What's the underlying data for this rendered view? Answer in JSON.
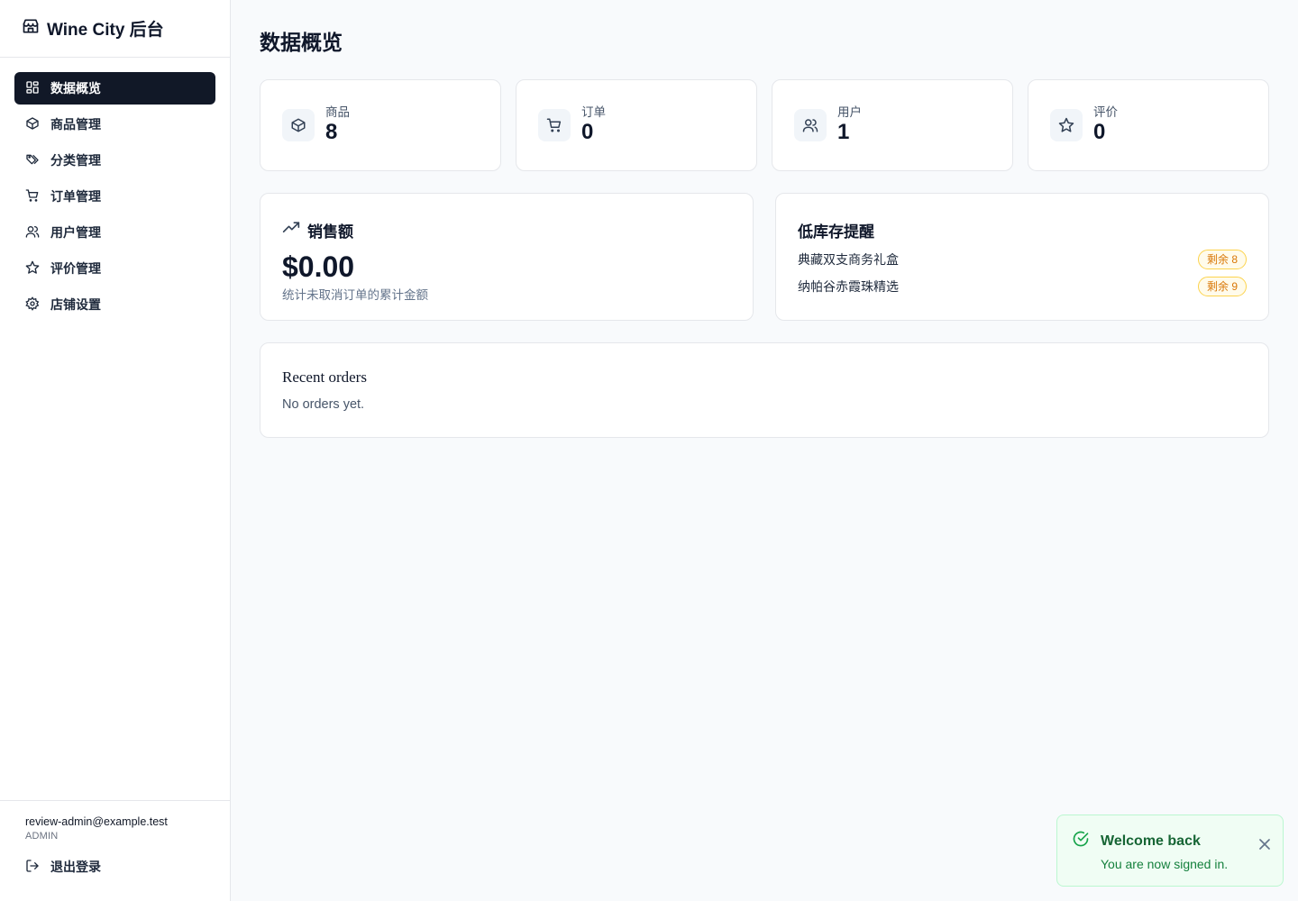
{
  "brand": {
    "title": "Wine City 后台",
    "icon": "store-icon"
  },
  "sidebar": {
    "items": [
      {
        "label": "数据概览",
        "icon": "dashboard-icon",
        "active": true
      },
      {
        "label": "商品管理",
        "icon": "box-icon"
      },
      {
        "label": "分类管理",
        "icon": "tags-icon"
      },
      {
        "label": "订单管理",
        "icon": "cart-icon"
      },
      {
        "label": "用户管理",
        "icon": "users-icon"
      },
      {
        "label": "评价管理",
        "icon": "star-icon"
      },
      {
        "label": "店铺设置",
        "icon": "gear-icon"
      }
    ],
    "user_email": "review-admin@example.test",
    "user_role": "ADMIN",
    "logout_label": "退出登录"
  },
  "main": {
    "title": "数据概览",
    "stats": [
      {
        "label": "商品",
        "value": "8",
        "icon": "box-icon"
      },
      {
        "label": "订单",
        "value": "0",
        "icon": "cart-icon"
      },
      {
        "label": "用户",
        "value": "1",
        "icon": "users-icon"
      },
      {
        "label": "评价",
        "value": "0",
        "icon": "star-icon"
      }
    ],
    "sales": {
      "title": "销售额",
      "value": "$0.00",
      "note": "统计未取消订单的累计金额",
      "icon": "trending-up-icon"
    },
    "low_stock": {
      "title": "低库存提醒",
      "items": [
        {
          "name": "典藏双支商务礼盒",
          "badge": "剩余 8"
        },
        {
          "name": "纳帕谷赤霞珠精选",
          "badge": "剩余 9"
        }
      ]
    },
    "recent_orders": {
      "title": "Recent orders",
      "empty": "No orders yet."
    }
  },
  "toast": {
    "title": "Welcome back",
    "message": "You are now signed in.",
    "icon": "check-circle-icon"
  },
  "colors": {
    "accent": "#111827",
    "success": "#16a34a",
    "warning": "#d97706"
  }
}
